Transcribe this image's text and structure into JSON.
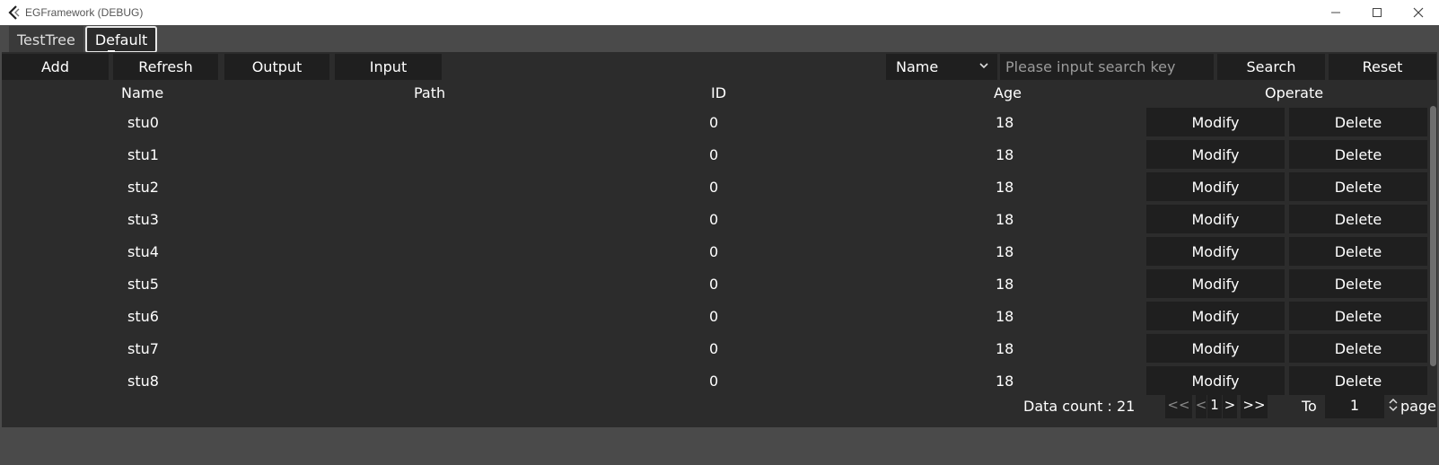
{
  "window": {
    "title": "EGFramework (DEBUG)",
    "minimize_icon": "minimize-icon",
    "maximize_icon": "maximize-icon",
    "close_icon": "close-icon"
  },
  "tabs": [
    {
      "label": "TestTree"
    },
    {
      "label": "Default"
    }
  ],
  "toolbar": {
    "add": "Add",
    "refresh": "Refresh",
    "output": "Output",
    "input": "Input"
  },
  "search": {
    "field_selected": "Name",
    "placeholder": "Please input search key",
    "search_label": "Search",
    "reset_label": "Reset"
  },
  "table": {
    "columns": [
      "Name",
      "Path",
      "ID",
      "Age",
      "Operate"
    ],
    "rows": [
      {
        "name": "stu0",
        "path": "",
        "id": "0",
        "age": "18"
      },
      {
        "name": "stu1",
        "path": "",
        "id": "0",
        "age": "18"
      },
      {
        "name": "stu2",
        "path": "",
        "id": "0",
        "age": "18"
      },
      {
        "name": "stu3",
        "path": "",
        "id": "0",
        "age": "18"
      },
      {
        "name": "stu4",
        "path": "",
        "id": "0",
        "age": "18"
      },
      {
        "name": "stu5",
        "path": "",
        "id": "0",
        "age": "18"
      },
      {
        "name": "stu6",
        "path": "",
        "id": "0",
        "age": "18"
      },
      {
        "name": "stu7",
        "path": "",
        "id": "0",
        "age": "18"
      },
      {
        "name": "stu8",
        "path": "",
        "id": "0",
        "age": "18"
      }
    ],
    "modify_label": "Modify",
    "delete_label": "Delete"
  },
  "pagination": {
    "data_count": "Data count : 21",
    "first": "<<",
    "prev": "<",
    "current": "1",
    "next": ">",
    "last": ">>",
    "to_label": "To",
    "goto_value": "1",
    "page_label": "page"
  }
}
